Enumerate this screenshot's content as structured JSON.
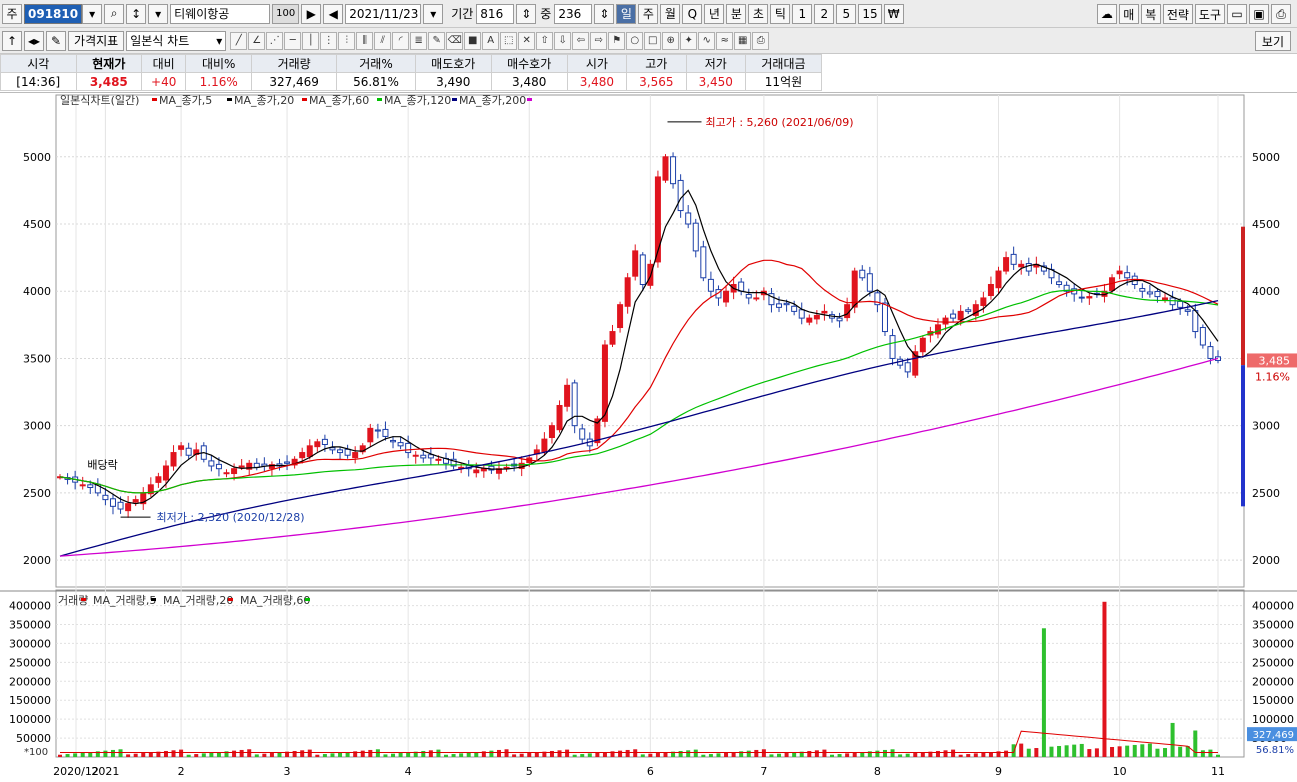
{
  "toolbar": {
    "market_label": "주",
    "code": "091810",
    "stock_name": "티웨이항공",
    "name_badge": "100",
    "date": "2021/11/23",
    "period_label": "기간",
    "period_value": "816",
    "count_label": "중",
    "count_value": "236",
    "intervals": [
      "일",
      "주",
      "월",
      "Q",
      "년",
      "분",
      "초",
      "틱",
      "1",
      "2",
      "5",
      "15",
      "₩"
    ],
    "selected_interval": "일",
    "right_buttons": [
      "매",
      "복",
      "전략",
      "도구"
    ],
    "indicator_button": "가격지표",
    "chart_type": "일본식 차트",
    "view_button": "보기"
  },
  "quote": {
    "headers": [
      "시각",
      "현재가",
      "대비",
      "대비%",
      "거래량",
      "거래%",
      "매도호가",
      "매수호가",
      "시가",
      "고가",
      "저가",
      "거래대금"
    ],
    "values": [
      "[14:36]",
      "3,485",
      "+40",
      "1.16%",
      "327,469",
      "56.81%",
      "3,490",
      "3,480",
      "3,480",
      "3,565",
      "3,450",
      "11억원"
    ]
  },
  "price_panel": {
    "title": "일본식차트(일간)",
    "legend": [
      "MA_종가,5",
      "MA_종가,20",
      "MA_종가,60",
      "MA_종가,120",
      "MA_종가,200"
    ],
    "legend_colors": [
      "#e00000",
      "#000000",
      "#e00000",
      "#00c000",
      "#000080",
      "#d000d0"
    ],
    "max_label": "최고가 : 5,260 (2021/06/09)",
    "min_label": "최저가 : 2,320 (2020/12/28)",
    "dividend_label": "배당락",
    "current_price_label": "3,485",
    "current_change_label": "1.16%"
  },
  "volume_panel": {
    "legend": [
      "거래량",
      "MA_거래량,5",
      "MA_거래량,20",
      "MA_거래량,60"
    ],
    "scale_label": "*100",
    "current_volume_label": "327,469",
    "current_ratio_label": "56.81%"
  },
  "chart_data": {
    "type": "candlestick",
    "x_tick_labels": [
      "2020/12",
      "2021",
      "2",
      "3",
      "4",
      "5",
      "6",
      "7",
      "8",
      "9",
      "10",
      "11"
    ],
    "price_ticks": [
      2000,
      2500,
      3000,
      3500,
      4000,
      4500,
      5000
    ],
    "volume_ticks": [
      50000,
      100000,
      150000,
      200000,
      250000,
      300000,
      350000,
      400000
    ],
    "price_ylim": [
      1800,
      5400
    ],
    "volume_ylim": [
      0,
      420000
    ],
    "max_price": 5260,
    "min_price": 2320,
    "current_price": 3485,
    "series_close": [
      2620,
      2600,
      2580,
      2560,
      2540,
      2500,
      2450,
      2400,
      2380,
      2420,
      2450,
      2500,
      2560,
      2620,
      2700,
      2800,
      2850,
      2780,
      2820,
      2750,
      2700,
      2680,
      2650,
      2680,
      2700,
      2720,
      2690,
      2700,
      2710,
      2700,
      2720,
      2750,
      2800,
      2850,
      2880,
      2860,
      2820,
      2800,
      2780,
      2800,
      2850,
      2980,
      2960,
      2920,
      2880,
      2850,
      2800,
      2780,
      2760,
      2760,
      2750,
      2720,
      2700,
      2690,
      2680,
      2670,
      2680,
      2670,
      2680,
      2690,
      2700,
      2720,
      2760,
      2820,
      2900,
      3000,
      3150,
      3300,
      3000,
      2900,
      2850,
      3050,
      3600,
      3700,
      3900,
      4100,
      4300,
      4050,
      4200,
      4850,
      5000,
      4800,
      4600,
      4500,
      4300,
      4100,
      4000,
      3950,
      4000,
      4050,
      4000,
      3950,
      3950,
      4000,
      3900,
      3880,
      3900,
      3850,
      3800,
      3800,
      3820,
      3850,
      3800,
      3780,
      3900,
      4150,
      4100,
      4000,
      3900,
      3700,
      3500,
      3450,
      3400,
      3550,
      3650,
      3700,
      3750,
      3800,
      3800,
      3850,
      3850,
      3900,
      3950,
      4050,
      4150,
      4250,
      4200,
      4200,
      4150,
      4200,
      4150,
      4100,
      4050,
      4000,
      3980,
      3950,
      3960,
      3980,
      4000,
      4100,
      4150,
      4100,
      4050,
      4000,
      3980,
      3960,
      3950,
      3900,
      3880,
      3850,
      3700,
      3600,
      3500,
      3485
    ],
    "volume_spikes": [
      [
        130,
        340000
      ],
      [
        138,
        410000
      ],
      [
        147,
        90000
      ],
      [
        150,
        70000
      ]
    ]
  }
}
